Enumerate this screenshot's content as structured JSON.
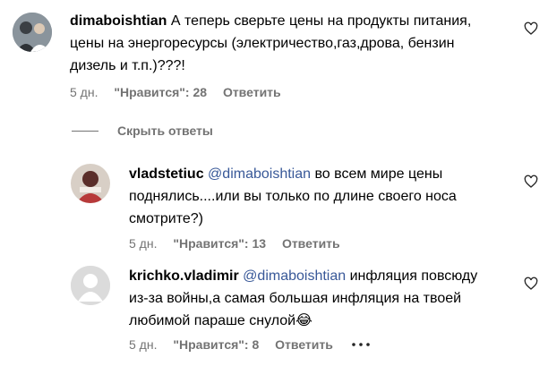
{
  "comments": [
    {
      "username": "dimaboishtian",
      "mention": "",
      "lines": [
        "А теперь сверьте цены на продукты питания,",
        "цены на энергоресурсы (электричество,газ,дрова, бензин",
        "дизель и т.п.)???!"
      ],
      "time": "5 дн.",
      "likes": "\"Нравится\": 28",
      "reply": "Ответить"
    },
    {
      "username": "vladstetiuc",
      "mention": "@dimaboishtian",
      "lines": [
        "во всем мире цены",
        "поднялись....или вы только по длине своего носа",
        "смотрите?)"
      ],
      "time": "5 дн.",
      "likes": "\"Нравится\": 13",
      "reply": "Ответить"
    },
    {
      "username": "krichko.vladimir",
      "mention": "@dimaboishtian",
      "lines": [
        "инфляция повсюду",
        "из-за войны,а самая большая инфляция на твоей",
        "любимой параше снулой"
      ],
      "emoji": "😂",
      "time": "5 дн.",
      "likes": "\"Нравится\": 8",
      "reply": "Ответить"
    }
  ],
  "hide_replies": "Скрыть ответы"
}
